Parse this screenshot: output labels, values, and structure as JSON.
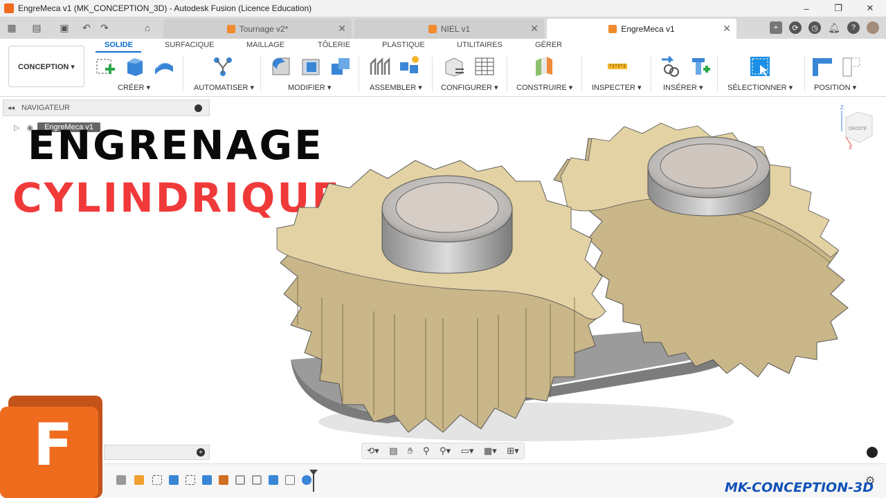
{
  "window": {
    "title": "EngreMeca v1 (MK_CONCEPTION_3D) - Autodesk Fusion (Licence Education)",
    "controls": [
      "–",
      "❐",
      "✕"
    ]
  },
  "tabs": [
    {
      "label": "Tournage v2*",
      "active": false
    },
    {
      "label": "NIEL v1",
      "active": false
    },
    {
      "label": "EngreMeca v1",
      "active": true
    }
  ],
  "ribbon": {
    "workspace": "CONCEPTION ▾",
    "tabs": [
      "SOLIDE",
      "SURFACIQUE",
      "MAILLAGE",
      "TÔLERIE",
      "PLASTIQUE",
      "UTILITAIRES",
      "GÉRER"
    ],
    "groups": [
      "CRÉER ▾",
      "AUTOMATISER ▾",
      "MODIFIER ▾",
      "ASSEMBLER ▾",
      "CONFIGURER ▾",
      "CONSTRUIRE ▾",
      "INSPECTER ▾",
      "INSÉRER ▾",
      "SÉLECTIONNER ▾",
      "POSITION ▾"
    ]
  },
  "navigator": {
    "title": "NAVIGATEUR",
    "root": "EngreMeca v1"
  },
  "overlay": {
    "line1": "ENGRENAGE",
    "line2": "CYLINDRIQUE",
    "line2_color": "#f03a3a"
  },
  "viewcube": {
    "face": "DROITE",
    "axis_z": "Z",
    "axis_x": "X"
  },
  "logo": {
    "letter": "F",
    "color": "#ef6c1f"
  },
  "watermark": "MK-CONCEPTION-3D",
  "colors": {
    "accent": "#0b6fd0",
    "gear": "#d9c89a",
    "gear_side": "#cbb88a",
    "hub": "#c8c8c8",
    "base": "#8a8a8a"
  }
}
